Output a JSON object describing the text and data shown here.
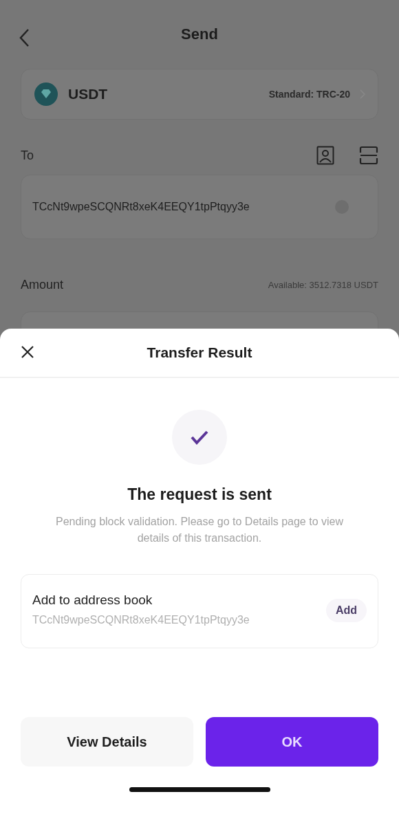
{
  "screen": {
    "title": "Send",
    "token": {
      "symbol": "USDT",
      "standard": "Standard: TRC-20"
    },
    "to": {
      "label": "To",
      "address": "TCcNt9wpeSCQNRt8xeK4EEQY1tpPtqyy3e"
    },
    "amount": {
      "label": "Amount",
      "available": "Available: 3512.7318 USDT"
    }
  },
  "sheet": {
    "title": "Transfer Result",
    "heading": "The request is sent",
    "message": "Pending block validation. Please go to Details page to view details of this transaction.",
    "address_book": {
      "label": "Add to address book",
      "address": "TCcNt9wpeSCQNRt8xeK4EEQY1tpPtqyy3e",
      "button": "Add"
    },
    "buttons": [
      {
        "label": "View Details",
        "kind": "secondary"
      },
      {
        "label": "OK",
        "kind": "primary"
      }
    ]
  }
}
